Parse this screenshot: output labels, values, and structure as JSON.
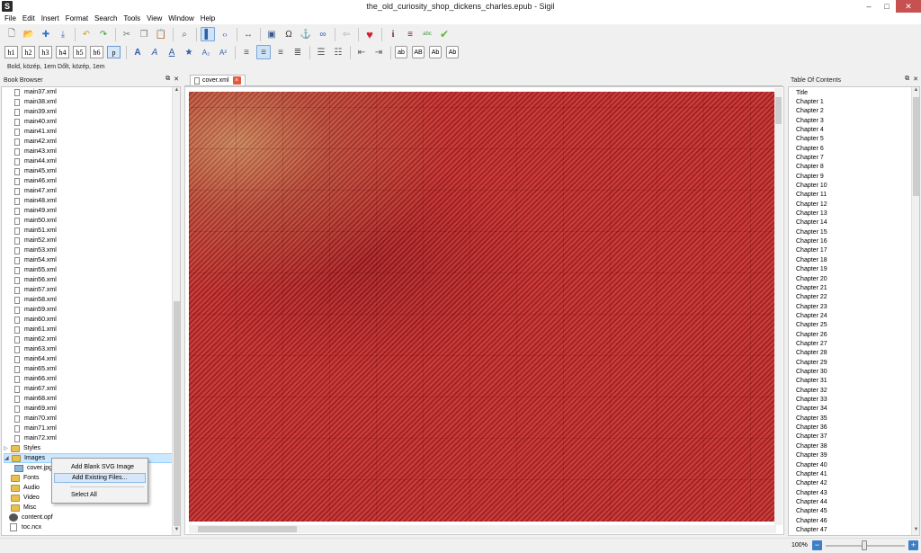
{
  "window": {
    "title": "the_old_curiosity_shop_dickens_charles.epub - Sigil",
    "app_icon": "S",
    "minimize": "–",
    "maximize": "□",
    "close": "✕"
  },
  "menu": [
    "File",
    "Edit",
    "Insert",
    "Format",
    "Search",
    "Tools",
    "View",
    "Window",
    "Help"
  ],
  "toolbar1": [
    {
      "name": "new-icon",
      "glyph": "🗋"
    },
    {
      "name": "open-icon",
      "glyph": "📂"
    },
    {
      "name": "add-icon",
      "glyph": "✚"
    },
    {
      "name": "save-icon",
      "glyph": "⤓"
    },
    {
      "name": "undo-icon",
      "glyph": "↶"
    },
    {
      "name": "redo-icon",
      "glyph": "↷"
    },
    {
      "name": "cut-icon",
      "glyph": "✂"
    },
    {
      "name": "copy-icon",
      "glyph": "❐"
    },
    {
      "name": "paste-icon",
      "glyph": "📋"
    },
    {
      "name": "find-icon",
      "glyph": "⌕"
    },
    {
      "name": "book-view-icon",
      "glyph": "▌"
    },
    {
      "name": "code-view-icon",
      "glyph": "‹›"
    },
    {
      "name": "split-view-icon",
      "glyph": "↔"
    },
    {
      "name": "insert-image-icon",
      "glyph": "▣"
    },
    {
      "name": "special-char-icon",
      "glyph": "Ω"
    },
    {
      "name": "anchor-icon",
      "glyph": "⚓"
    },
    {
      "name": "link-icon",
      "glyph": "∞"
    },
    {
      "name": "back-icon",
      "glyph": "⇦"
    },
    {
      "name": "donate-heart-icon",
      "glyph": "♥"
    },
    {
      "name": "metadata-icon",
      "glyph": "i"
    },
    {
      "name": "toc-edit-icon",
      "glyph": "≡"
    },
    {
      "name": "spellcheck-icon",
      "glyph": "abc"
    },
    {
      "name": "validate-icon",
      "glyph": "✔"
    }
  ],
  "heading_buttons": [
    "h1",
    "h2",
    "h3",
    "h4",
    "h5",
    "h6",
    "p"
  ],
  "style_buttons": [
    "ab",
    "AB",
    "Ab",
    "Ab"
  ],
  "toolbar3_text": "Bold, közép, 1em  Dőlt, közép, 1em",
  "book_browser": {
    "title": "Book Browser",
    "files": [
      "main37.xml",
      "main38.xml",
      "main39.xml",
      "main40.xml",
      "main41.xml",
      "main42.xml",
      "main43.xml",
      "main44.xml",
      "main45.xml",
      "main46.xml",
      "main47.xml",
      "main48.xml",
      "main49.xml",
      "main50.xml",
      "main51.xml",
      "main52.xml",
      "main53.xml",
      "main54.xml",
      "main55.xml",
      "main56.xml",
      "main57.xml",
      "main58.xml",
      "main59.xml",
      "main60.xml",
      "main61.xml",
      "main62.xml",
      "main63.xml",
      "main64.xml",
      "main65.xml",
      "main66.xml",
      "main67.xml",
      "main68.xml",
      "main69.xml",
      "main70.xml",
      "main71.xml",
      "main72.xml"
    ],
    "styles_folder": "Styles",
    "images_folder": "Images",
    "image_file": "cover.jpg",
    "folders_after": [
      "Fonts",
      "Audio",
      "Video",
      "Misc"
    ],
    "content_opf": "content.opf",
    "toc_ncx": "toc.ncx"
  },
  "context_menu": {
    "items": [
      "Add Blank SVG Image",
      "Add Existing Files...",
      "Select All"
    ]
  },
  "editor": {
    "tab_label": "cover.xml",
    "tab_close": "×"
  },
  "toc": {
    "title": "Table Of Contents",
    "entries": [
      "Title",
      "Chapter 1",
      "Chapter 2",
      "Chapter 3",
      "Chapter 4",
      "Chapter 5",
      "Chapter 6",
      "Chapter 7",
      "Chapter 8",
      "Chapter 9",
      "Chapter 10",
      "Chapter 11",
      "Chapter 12",
      "Chapter 13",
      "Chapter 14",
      "Chapter 15",
      "Chapter 16",
      "Chapter 17",
      "Chapter 18",
      "Chapter 19",
      "Chapter 20",
      "Chapter 21",
      "Chapter 22",
      "Chapter 23",
      "Chapter 24",
      "Chapter 25",
      "Chapter 26",
      "Chapter 27",
      "Chapter 28",
      "Chapter 29",
      "Chapter 30",
      "Chapter 31",
      "Chapter 32",
      "Chapter 33",
      "Chapter 34",
      "Chapter 35",
      "Chapter 36",
      "Chapter 37",
      "Chapter 38",
      "Chapter 39",
      "Chapter 40",
      "Chapter 41",
      "Chapter 42",
      "Chapter 43",
      "Chapter 44",
      "Chapter 45",
      "Chapter 46",
      "Chapter 47"
    ]
  },
  "status": {
    "zoom": "100%",
    "zoom_minus": "−",
    "zoom_plus": "+"
  },
  "colors": {
    "cover_red": "#b52a2b",
    "selection_blue": "#cce8ff",
    "close_red": "#c75050"
  }
}
